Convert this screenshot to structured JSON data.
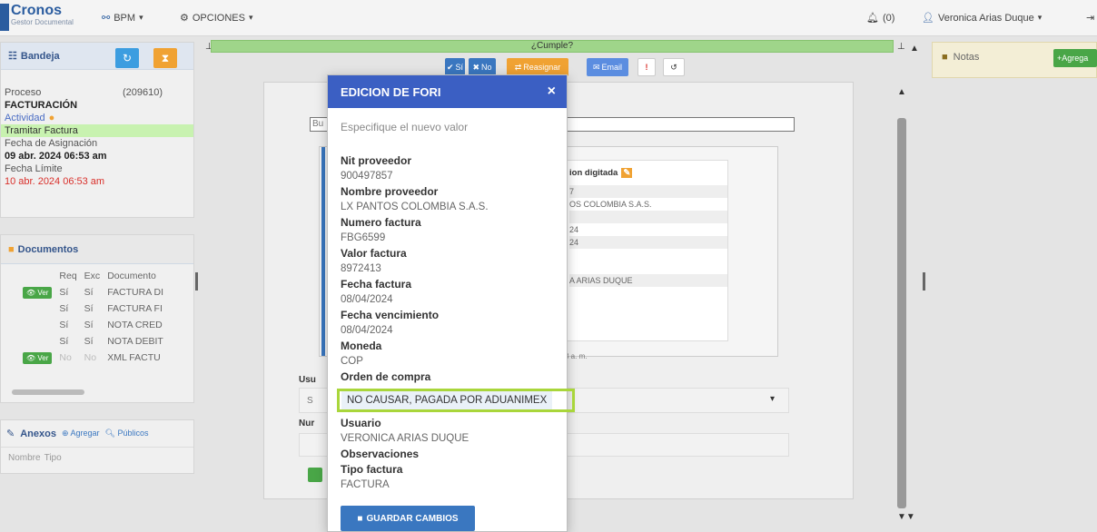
{
  "navbar": {
    "app_name": "Cronos",
    "app_subtitle": "Gestor Documental",
    "bpm_label": "BPM",
    "opciones_label": "OPCIONES",
    "notifications": "(0)",
    "user_name": "Veronica Arias Duque"
  },
  "bandeja": {
    "title": "Bandeja",
    "proceso_label": "Proceso",
    "proceso_id": "(209610)",
    "proceso_value": "FACTURACIÓN",
    "actividad_label": "Actividad",
    "actividad_value": "Tramitar Factura",
    "fecha_asig_label": "Fecha de Asignación",
    "fecha_asig_value": "09 abr. 2024 06:53 am",
    "fecha_lim_label": "Fecha Límite",
    "fecha_lim_value": "10 abr. 2024 06:53 am"
  },
  "documentos": {
    "title": "Documentos",
    "columns": [
      "Req",
      "Exc",
      "Documento"
    ],
    "view_label": "Ver",
    "rows": [
      {
        "req": "Sí",
        "exc": "Sí",
        "doc": "FACTURA DI",
        "has_view": true
      },
      {
        "req": "Sí",
        "exc": "Sí",
        "doc": "FACTURA FI",
        "has_view": false
      },
      {
        "req": "Sí",
        "exc": "Sí",
        "doc": "NOTA CRED",
        "has_view": false
      },
      {
        "req": "Sí",
        "exc": "Sí",
        "doc": "NOTA DEBIT",
        "has_view": false
      },
      {
        "req": "No",
        "exc": "No",
        "doc": "XML FACTU",
        "has_view": true
      }
    ]
  },
  "anexos": {
    "title": "Anexos",
    "agregar": "Agregar",
    "publicos": "Públicos",
    "col_nombre": "Nombre",
    "col_tipo": "Tipo"
  },
  "center": {
    "cumple_label": "¿Cumple?",
    "btn_si": "Sí",
    "btn_no": "No",
    "btn_reasignar": "Reasignar",
    "btn_email": "Email",
    "bg_digitada": "ion digitada",
    "bg_rows": [
      "7",
      "OS COLOMBIA S.A.S.",
      "",
      "24",
      "24",
      "",
      "A ARIAS DUQUE"
    ],
    "bg_usu": "Usu",
    "bg_nur": "Nur",
    "bg_s": "S",
    "bg_bu": "Bu",
    "bg_time": "3 a. m."
  },
  "notes": {
    "title": "Notas",
    "add_label": "Agrega"
  },
  "modal": {
    "title": "EDICION DE FORI",
    "hint": "Especifique el nuevo valor",
    "fields": [
      {
        "label": "Nit proveedor",
        "value": "900497857"
      },
      {
        "label": "Nombre proveedor",
        "value": "LX PANTOS COLOMBIA S.A.S."
      },
      {
        "label": "Numero factura",
        "value": "FBG6599"
      },
      {
        "label": "Valor factura",
        "value": "8972413"
      },
      {
        "label": "Fecha factura",
        "value": "08/04/2024"
      },
      {
        "label": "Fecha vencimiento",
        "value": "08/04/2024"
      },
      {
        "label": "Moneda",
        "value": "COP"
      }
    ],
    "orden_label": "Orden de compra",
    "orden_value": "NO CAUSAR, PAGADA POR ADUANIMEX",
    "usuario_label": "Usuario",
    "usuario_value": "VERONICA ARIAS DUQUE",
    "observaciones_label": "Observaciones",
    "tipo_label": "Tipo factura",
    "tipo_value": "FACTURA",
    "save_label": "GUARDAR CAMBIOS"
  },
  "colors": {
    "brand_blue": "#3b5fc3",
    "green": "#49a647",
    "highlight": "#a9d63b"
  }
}
